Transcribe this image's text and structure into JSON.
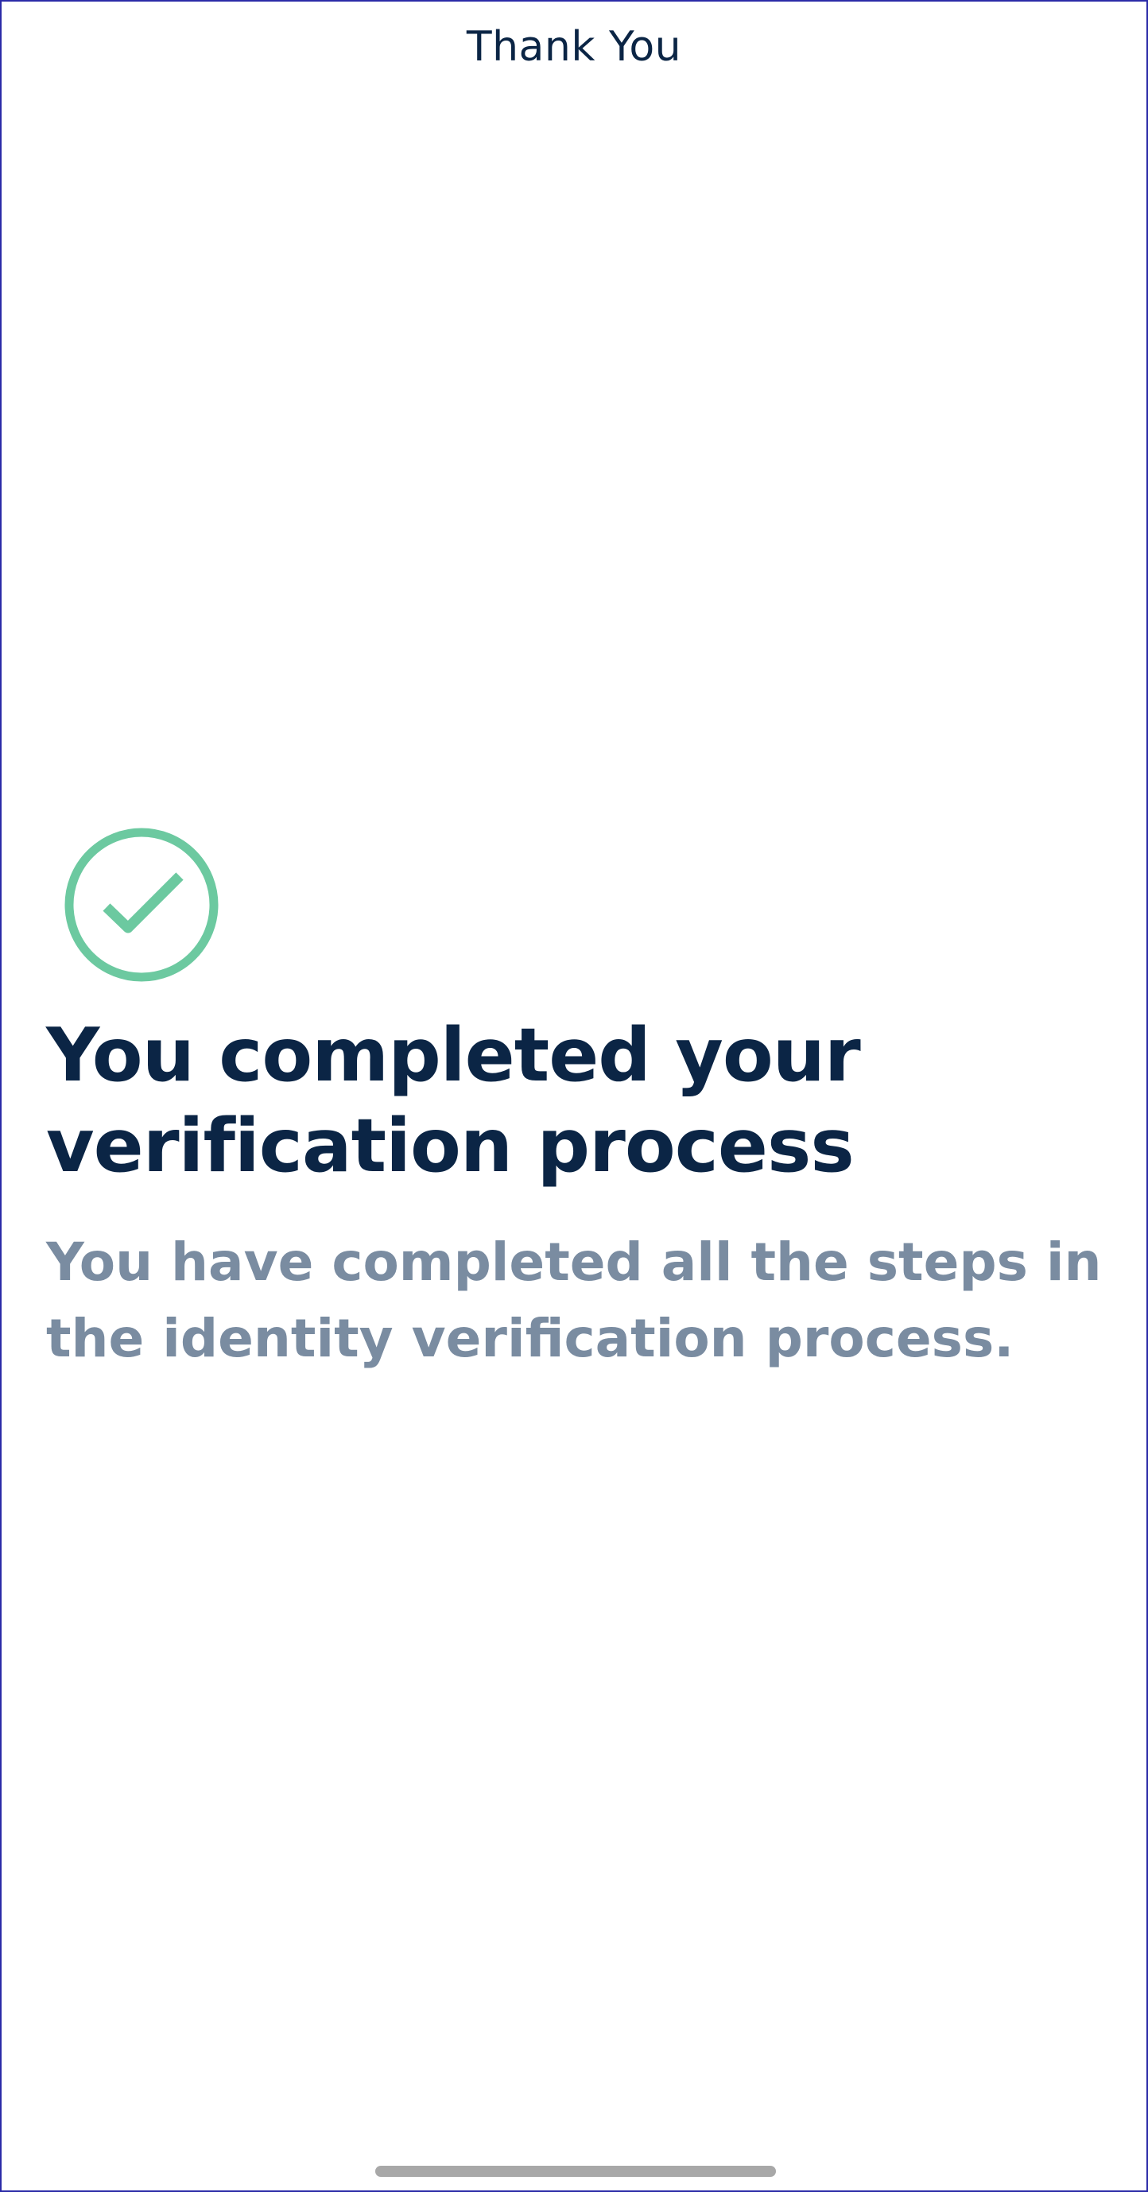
{
  "header": {
    "title": "Thank You"
  },
  "status": {
    "icon": "check-circle-icon",
    "color": "#6cc9a0"
  },
  "main": {
    "headline": "You completed your verification process",
    "description": "You have completed all the steps in the identity verification process."
  },
  "colors": {
    "text_primary": "#0b2545",
    "text_secondary": "#7a8ca1",
    "success": "#6cc9a0"
  }
}
